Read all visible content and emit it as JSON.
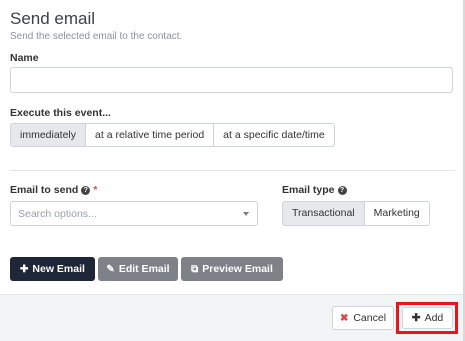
{
  "dialog": {
    "title": "Send email",
    "subtitle": "Send the selected email to the contact."
  },
  "name_field": {
    "label": "Name",
    "value": "",
    "placeholder": ""
  },
  "execute": {
    "label": "Execute this event...",
    "options": [
      "immediately",
      "at a relative time period",
      "at a specific date/time"
    ],
    "selected": "immediately"
  },
  "email_to_send": {
    "label": "Email to send",
    "required_mark": "*",
    "placeholder": "Search options..."
  },
  "email_type": {
    "label": "Email type",
    "options": [
      "Transactional",
      "Marketing"
    ],
    "selected": "Transactional"
  },
  "actions": {
    "new_email": "New Email",
    "edit_email": "Edit Email",
    "preview_email": "Preview Email"
  },
  "footer": {
    "cancel": "Cancel",
    "add": "Add"
  },
  "icons": {
    "help": "question-circle-icon",
    "new": "plus-icon",
    "edit": "edit-icon",
    "preview": "external-link-icon",
    "cancel": "times-icon",
    "add": "plus-icon",
    "dropdown": "caret-down-icon"
  },
  "colors": {
    "primary_dark": "#1f2638",
    "secondary_gray": "#7e8187",
    "danger": "#e64545",
    "highlight": "#e8151b",
    "active_segment": "#e6e8eb"
  }
}
